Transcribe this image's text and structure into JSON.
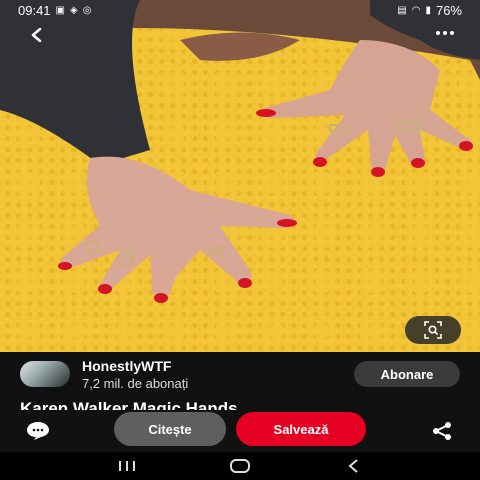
{
  "status_bar": {
    "time": "09:41",
    "battery": "76%",
    "left_icons": [
      "image-icon",
      "notification-icon",
      "whatsapp-icon"
    ],
    "right_icons": [
      "nfc-icon",
      "wifi-icon",
      "signal-icon",
      "battery-icon"
    ]
  },
  "pin": {
    "image_alt": "Karen Walker Magic Hands",
    "title": "Karen Walker Magic Hands"
  },
  "creator": {
    "name": "HonestlyWTF",
    "followers": "7,2 mil. de abonați",
    "follow_label": "Abonare"
  },
  "actions": {
    "read_label": "Citește",
    "save_label": "Salvează"
  },
  "icons": {
    "back": "back-arrow-icon",
    "more": "more-options-icon",
    "lens": "visual-search-icon",
    "comment": "comment-icon",
    "share": "share-icon"
  },
  "colors": {
    "save_button": "#e60023",
    "read_button": "#5f5f5f",
    "follow_button": "#3b3b3b",
    "background": "#111111",
    "nail_polish": "#d41424",
    "fabric": "#f2c636"
  }
}
